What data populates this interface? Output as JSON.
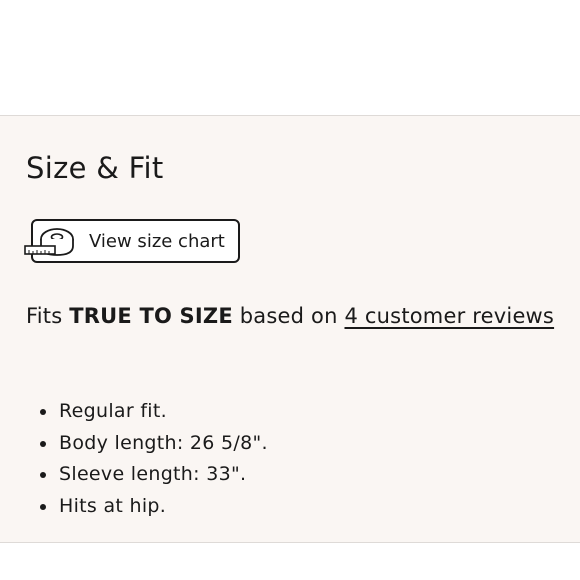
{
  "section": {
    "title": "Size & Fit"
  },
  "size_chart": {
    "label": "View size chart",
    "icon": "measuring-tape-icon"
  },
  "fit": {
    "prefix": "Fits",
    "rating": "TRUE TO SIZE",
    "middle": "based on",
    "reviews_link": "4 customer reviews"
  },
  "details": [
    "Regular fit.",
    "Body length: 26 5/8\".",
    "Sleeve length: 33\".",
    "Hits at hip."
  ],
  "colors": {
    "panel_background": "#faf6f3",
    "text": "#1a1a1a",
    "divider": "#dedad7"
  }
}
